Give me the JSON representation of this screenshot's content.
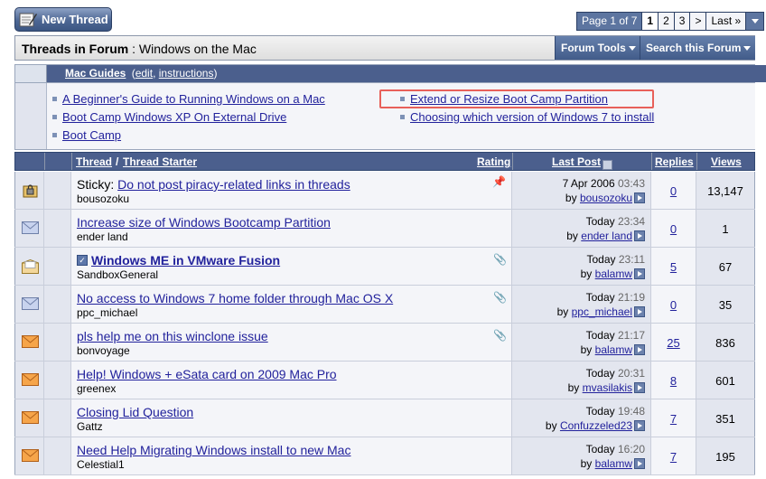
{
  "toolbar": {
    "new_thread_label": "New Thread"
  },
  "pager": {
    "label": "Page 1 of 7",
    "pages": [
      "1",
      "2",
      "3"
    ],
    "next": ">",
    "last": "Last »",
    "current": "1"
  },
  "header": {
    "title_prefix": "Threads in Forum",
    "title_sep": ":",
    "forum_name": "Windows on the Mac",
    "forum_tools": "Forum Tools",
    "search_forum": "Search this Forum"
  },
  "guides": {
    "title": "Mac Guides",
    "paren_open": "(",
    "edit": "edit",
    "comma": ",",
    "instructions": "instructions",
    "paren_close": ")",
    "items": [
      "A Beginner's Guide to Running Windows on a Mac",
      "Boot Camp Windows XP On External Drive",
      "Boot Camp",
      "Extend or Resize Boot Camp Partition",
      "Choosing which version of Windows 7 to install"
    ]
  },
  "columns": {
    "thread": "Thread",
    "slash": "/",
    "starter": "Thread Starter",
    "rating": "Rating",
    "last_post": "Last Post",
    "replies": "Replies",
    "views": "Views"
  },
  "threads": [
    {
      "prefix": "Sticky:",
      "title": "Do not post piracy-related links in threads",
      "starter": "bousozoku",
      "date": "7 Apr 2006",
      "time": "03:43",
      "by": "by",
      "last_user": "bousozoku",
      "replies": "0",
      "views": "13,147",
      "icon": "lock-folder-icon"
    },
    {
      "prefix": "",
      "title": "Increase size of Windows Bootcamp Partition",
      "starter": "ender land",
      "date": "Today",
      "time": "23:34",
      "by": "by",
      "last_user": "ender land",
      "replies": "0",
      "views": "1",
      "icon": "envelope-icon"
    },
    {
      "prefix": "",
      "title": "Windows ME in VMware Fusion",
      "starter": "SandboxGeneral",
      "date": "Today",
      "time": "23:11",
      "by": "by",
      "last_user": "balamw",
      "replies": "5",
      "views": "67",
      "icon": "open-envelope-icon"
    },
    {
      "prefix": "",
      "title": "No access to Windows 7 home folder through Mac OS X",
      "starter": "ppc_michael",
      "date": "Today",
      "time": "21:19",
      "by": "by",
      "last_user": "ppc_michael",
      "replies": "0",
      "views": "35",
      "icon": "envelope-icon"
    },
    {
      "prefix": "",
      "title": "pls help me on this winclone issue",
      "starter": "bonvoyage",
      "date": "Today",
      "time": "21:17",
      "by": "by",
      "last_user": "balamw",
      "replies": "25",
      "views": "836",
      "icon": "hot-envelope-icon"
    },
    {
      "prefix": "",
      "title": "Help! Windows + eSata card on 2009 Mac Pro",
      "starter": "greenex",
      "date": "Today",
      "time": "20:31",
      "by": "by",
      "last_user": "mvasilakis",
      "replies": "8",
      "views": "601",
      "icon": "hot-envelope-icon"
    },
    {
      "prefix": "",
      "title": "Closing Lid Question",
      "starter": "Gattz",
      "date": "Today",
      "time": "19:48",
      "by": "by",
      "last_user": "Confuzzeled23",
      "replies": "7",
      "views": "351",
      "icon": "hot-envelope-icon"
    },
    {
      "prefix": "",
      "title": "Need Help Migrating Windows install to new Mac",
      "starter": "Celestial1",
      "date": "Today",
      "time": "16:20",
      "by": "by",
      "last_user": "balamw",
      "replies": "7",
      "views": "195",
      "icon": "hot-envelope-icon"
    }
  ]
}
